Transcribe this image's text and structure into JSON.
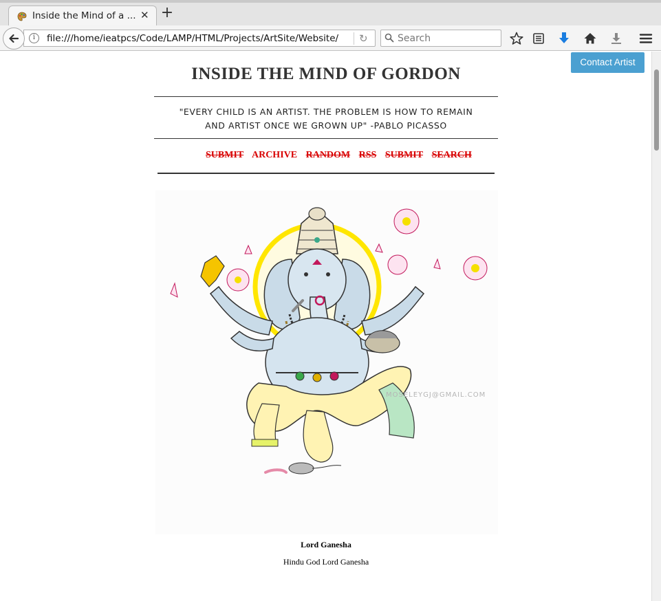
{
  "browser": {
    "tab_title": "Inside the Mind of a ...",
    "url": "file:///home/ieatpcs/Code/LAMP/HTML/Projects/ArtSite/Website/",
    "search_placeholder": "Search"
  },
  "toolbar_icons": [
    "star-icon",
    "reading-list-icon",
    "download-arrow-icon",
    "home-icon",
    "downloads-icon",
    "menu-icon"
  ],
  "page": {
    "contact_label": "Contact Artist",
    "site_title": "INSIDE THE MIND OF GORDON",
    "quote_line1": "\"EVERY CHILD IS AN ARTIST. THE PROBLEM IS HOW TO REMAIN",
    "quote_line2": "AND ARTIST ONCE WE GROWN UP\" -PABLO PICASSO",
    "nav": [
      {
        "label": "SUBMIT",
        "strike": true
      },
      {
        "label": "ARCHIVE",
        "strike": false
      },
      {
        "label": "RANDOM",
        "strike": true
      },
      {
        "label": "RSS",
        "strike": true
      },
      {
        "label": "SUBMIT",
        "strike": true
      },
      {
        "label": "SEARCH",
        "strike": true
      }
    ],
    "artwork": {
      "title": "Lord Ganesha",
      "description": "Hindu God Lord Ganesha",
      "watermark": "MOSELEYGJ@GMAIL.COM"
    }
  },
  "colors": {
    "nav_link": "#d80000",
    "contact_button": "#4ba0d1"
  }
}
